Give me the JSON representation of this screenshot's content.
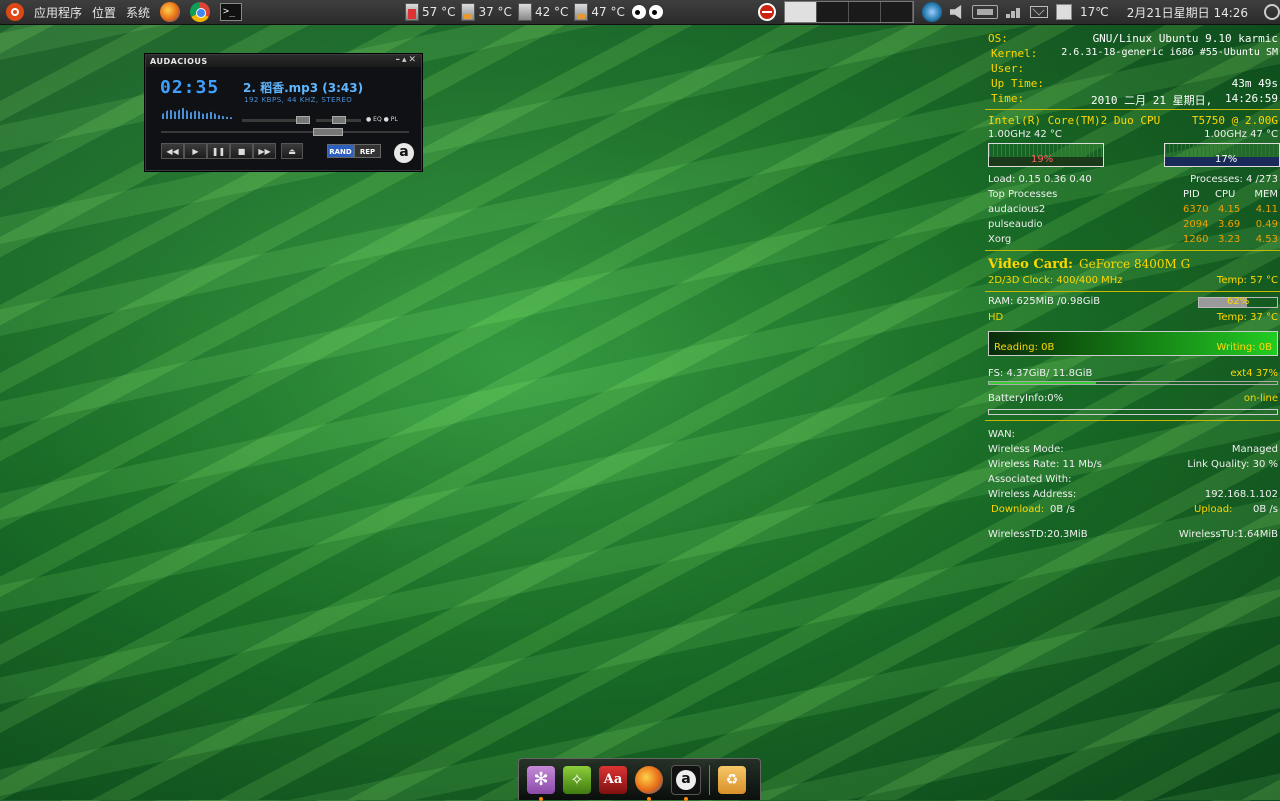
{
  "top_panel": {
    "menu_apps": "应用程序",
    "menu_places": "位置",
    "menu_system": "系统",
    "terminal_prompt": ">_",
    "temps": [
      "57 °C",
      "37 °C",
      "42 °C",
      "47 °C"
    ],
    "weather_temp": "17℃",
    "clock": "2月21日星期日 14:26"
  },
  "audacious": {
    "title": "AUDACIOUS",
    "window_controls": "–▴✕",
    "time": "02:35",
    "track": "2. 稻香.mp3 (3:43)",
    "info": "192 KBPS, 44 KHZ, STEREO",
    "eq": "EQ",
    "pl": "PL",
    "buttons": [
      "◀◀",
      "▶",
      "❚❚",
      "■",
      "▶▶"
    ],
    "eject": "⏏",
    "rand": "RAND",
    "rep": "REP",
    "logo": "a"
  },
  "conky": {
    "os_label": "OS:",
    "os_value": "GNU/Linux Ubuntu 9.10 karmic",
    "kernel_label": "Kernel:",
    "kernel_value": "2.6.31-18-generic i686 #55-Ubuntu SM",
    "user_label": "User:",
    "uptime_label": "Up Time:",
    "uptime_value": "43m 49s",
    "time_label": "Time:",
    "time_value": "2010 二月 21 星期日,",
    "time_clock": "14:26:59",
    "cpu_name": "Intel(R) Core(TM)2 Duo CPU",
    "cpu_model": "T5750  @ 2.00G",
    "cpu1_freq": "1.00GHz  42 °C",
    "cpu2_freq": "1.00GHz  47 °C",
    "cpu1_usage": "19%",
    "cpu2_usage": "17%",
    "load": "Load:  0.15 0.36 0.40",
    "processes": "Processes: 4   /273",
    "top_processes": "Top Processes",
    "col_pid": "PID",
    "col_cpu": "CPU",
    "col_mem": "MEM",
    "procs": [
      {
        "name": "audacious2",
        "pid": "6370",
        "cpu": "4.15",
        "mem": "4.11"
      },
      {
        "name": "pulseaudio",
        "pid": "2094",
        "cpu": "3.69",
        "mem": "0.49"
      },
      {
        "name": "Xorg",
        "pid": "1260",
        "cpu": "3.23",
        "mem": "4.53"
      }
    ],
    "video_label": "Video Card:",
    "video_value": "GeForce 8400M G",
    "gpu_clock": "2D/3D Clock: 400/400 MHz",
    "gpu_temp": "Temp: 57 °C",
    "ram": "RAM: 625MiB /0.98GiB",
    "ram_pct": "62%",
    "ram_fraction": 0.62,
    "hd_label": "HD",
    "hd_temp": "Temp: 37 °C",
    "reading": "Reading: 0B",
    "writing": "Writing: 0B",
    "fs": "FS: 4.37GiB/ 11.8GiB",
    "fs_type": "ext4 37%",
    "fs_fraction": 0.37,
    "battery": "BatteryInfo:0%",
    "battery_state": "on-line",
    "wan": "WAN:",
    "wireless_mode_label": "Wireless Mode:",
    "wireless_mode_value": "Managed",
    "wireless_rate": "Wireless Rate: 11 Mb/s",
    "link_quality": "Link Quality:  30   %",
    "associated": "Associated With:",
    "wireless_address_label": "Wireless Address:",
    "wireless_address_value": "192.168.1.102",
    "download_label": "Download:",
    "download_value": "0B     /s",
    "upload_label": "Upload:",
    "upload_value": "0B     /s",
    "wireless_td": "WirelessTD:20.3MiB",
    "wireless_tu": "WirelessTU:1.64MiB"
  },
  "dock": {
    "items": [
      "settings-icon",
      "app-icon",
      "dictionary-icon",
      "firefox-icon",
      "audacious-icon",
      "trash-icon"
    ],
    "dict_label": "Aa",
    "aud_label": "a"
  },
  "colors": {
    "accent_yellow": "#ffd700",
    "process_values": "#f0a000",
    "panel_bg": "#2b2b2b",
    "audacious_blue": "#3ea0ff"
  }
}
